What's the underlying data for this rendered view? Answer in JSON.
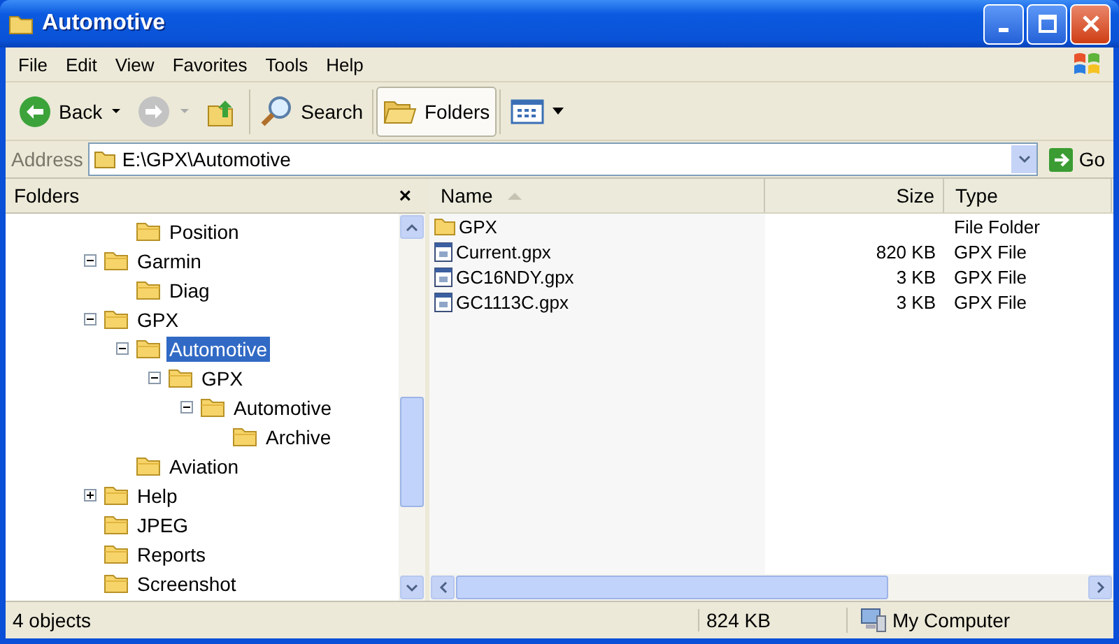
{
  "window": {
    "title": "Automotive"
  },
  "menu": [
    "File",
    "Edit",
    "View",
    "Favorites",
    "Tools",
    "Help"
  ],
  "toolbar": [
    {
      "kind": "back",
      "label": "Back"
    },
    {
      "kind": "forward",
      "disabled": true
    },
    {
      "kind": "up"
    },
    {
      "kind": "search",
      "label": "Search"
    },
    {
      "kind": "folders",
      "label": "Folders",
      "selected": true
    },
    {
      "kind": "views"
    }
  ],
  "address": {
    "label": "Address",
    "value": "E:\\GPX\\Automotive",
    "go": "Go"
  },
  "folders_pane": {
    "title": "Folders",
    "close": "×",
    "tree": [
      {
        "children": [
          {
            "label": "Position",
            "selected": false
          }
        ]
      },
      {
        "label": "Garmin",
        "expanded": true,
        "selected": false,
        "children": [
          {
            "label": "Diag",
            "selected": false
          }
        ]
      },
      {
        "label": "GPX",
        "expanded": true,
        "selected": false,
        "children": [
          {
            "label": "Automotive",
            "expanded": true,
            "selected": true,
            "children": [
              {
                "label": "GPX",
                "expanded": true,
                "selected": false,
                "children": [
                  {
                    "label": "Automotive",
                    "expanded": true,
                    "selected": false,
                    "children": [
                      {
                        "label": "Archive",
                        "selected": false
                      }
                    ]
                  }
                ]
              }
            ]
          },
          {
            "label": "Aviation",
            "selected": false
          }
        ]
      },
      {
        "label": "Help",
        "expanded": false,
        "selected": false
      },
      {
        "label": "JPEG",
        "selected": false
      },
      {
        "label": "Reports",
        "selected": false
      },
      {
        "label": "Screenshot",
        "selected": false
      }
    ]
  },
  "file_list": {
    "columns": [
      {
        "label": "Name",
        "sorted": true
      },
      {
        "label": "Size",
        "sorted": false
      },
      {
        "label": "Type",
        "sorted": false
      }
    ],
    "rows": [
      {
        "kind": "folder",
        "name": "GPX",
        "type": "File Folder"
      },
      {
        "kind": "file",
        "name": "Current.gpx",
        "size": "820 KB",
        "type": "GPX File"
      },
      {
        "kind": "file",
        "name": "GC16NDY.gpx",
        "size": "3 KB",
        "type": "GPX File"
      },
      {
        "kind": "file",
        "name": "GC1113C.gpx",
        "size": "3 KB",
        "type": "GPX File"
      }
    ]
  },
  "status_bar": {
    "count": "4 objects",
    "size": "824 KB",
    "zone": "My Computer"
  }
}
